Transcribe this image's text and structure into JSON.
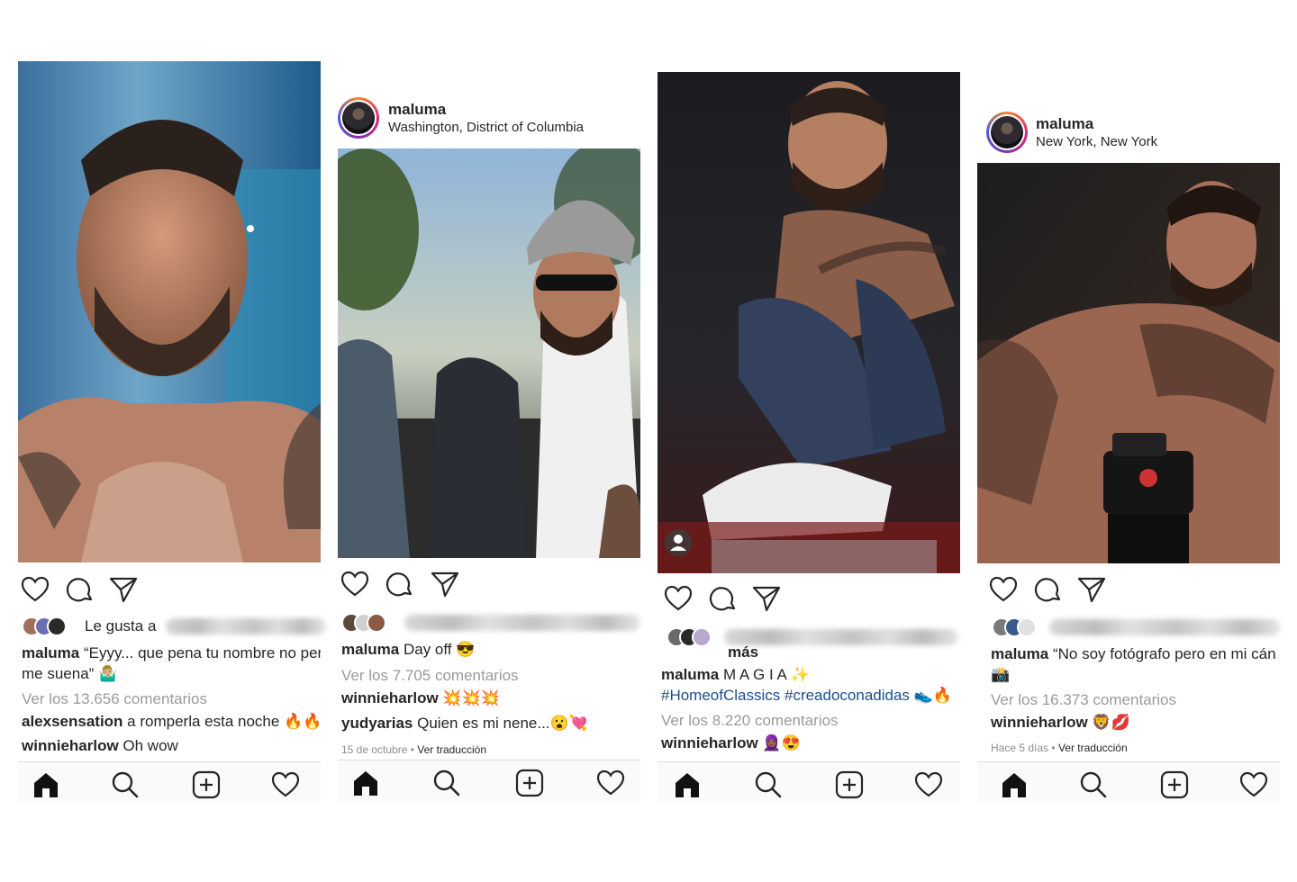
{
  "posts": [
    {
      "username": "",
      "location": "",
      "likes_text": "Le gusta a",
      "caption_user": "maluma",
      "caption_text_1": " “Eyyy... que pena tu nombre no per",
      "caption_text_2": "me suena” 🤷🏼‍♂️",
      "view_comments": "Ver los 13.656 comentarios",
      "comments": [
        {
          "user": "alexsensation",
          "text": " a romperla esta noche 🔥🔥"
        },
        {
          "user": "winnieharlow",
          "text": " Oh wow"
        }
      ],
      "date": "",
      "translate": ""
    },
    {
      "username": "maluma",
      "location": "Washington, District of Columbia",
      "likes_text": "",
      "caption_user": "maluma",
      "caption_text_1": " Day off 😎",
      "caption_text_2": "",
      "view_comments": "Ver los 7.705 comentarios",
      "comments": [
        {
          "user": "winnieharlow",
          "text": " 💥💥💥"
        },
        {
          "user": "yudyarias",
          "text": " Quien es mi nene...😮💘"
        }
      ],
      "date": "15 de octubre",
      "translate": "Ver traducción"
    },
    {
      "username": "",
      "location": "",
      "likes_text": "más",
      "caption_user": "maluma",
      "caption_text_1": " M A G I A ✨",
      "caption_text_2": "#HomeofClassics #creadoconadidas 👟🔥",
      "view_comments": "Ver los 8.220 comentarios",
      "comments": [
        {
          "user": "winnieharlow",
          "text": " 🧕🏾😍"
        }
      ],
      "date": "",
      "translate": ""
    },
    {
      "username": "maluma",
      "location": "New York, New York",
      "likes_text": "",
      "caption_user": "maluma",
      "caption_text_1": " “No soy fotógrafo pero en mi cán",
      "caption_text_2": "📸",
      "view_comments": "Ver los 16.373 comentarios",
      "comments": [
        {
          "user": "winnieharlow",
          "text": " 🦁💋"
        }
      ],
      "date": "Hace 5 días",
      "translate": "Ver traducción"
    }
  ],
  "icons": {
    "like": "heart-icon",
    "comment": "comment-icon",
    "share": "paper-plane-icon",
    "home": "home-icon",
    "search": "search-icon",
    "add": "add-post-icon",
    "activity": "heart-icon"
  },
  "colors": {
    "text": "#262626",
    "muted": "#9a9a9a",
    "hashtag": "#1a4f8a",
    "divider": "#dbdbdb"
  }
}
